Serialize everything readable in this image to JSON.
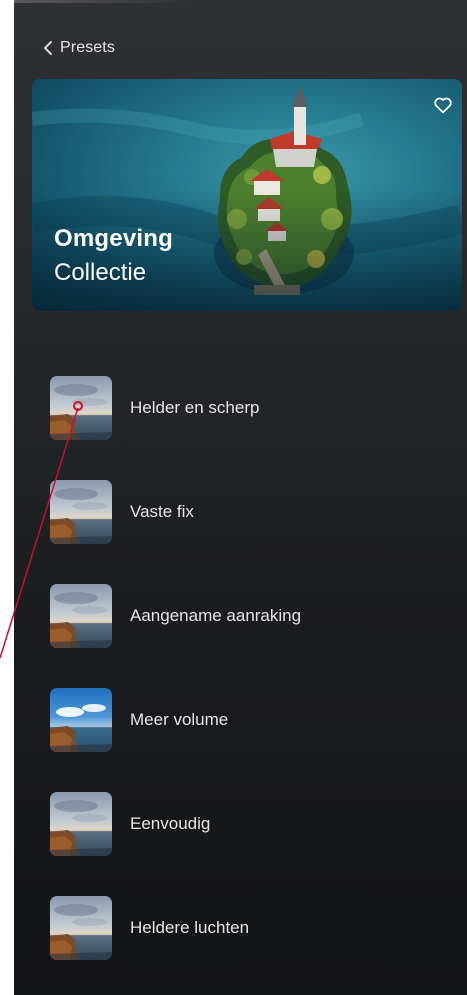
{
  "header": {
    "back_label": "Presets"
  },
  "hero": {
    "title": "Omgeving",
    "subtitle": "Collectie"
  },
  "presets": [
    {
      "label": "Helder en scherp",
      "sky": "overcast"
    },
    {
      "label": "Vaste fix",
      "sky": "overcast"
    },
    {
      "label": "Aangename aanraking",
      "sky": "overcast"
    },
    {
      "label": "Meer volume",
      "sky": "blue"
    },
    {
      "label": "Eenvoudig",
      "sky": "overcast"
    },
    {
      "label": "Heldere luchten",
      "sky": "overcast"
    }
  ],
  "colors": {
    "panel_bg": "#26282b",
    "annotation": "#c8102e",
    "text": "#e6e6e6"
  },
  "icons": {
    "back": "chevron-left-icon",
    "favorite": "heart-outline-icon"
  }
}
